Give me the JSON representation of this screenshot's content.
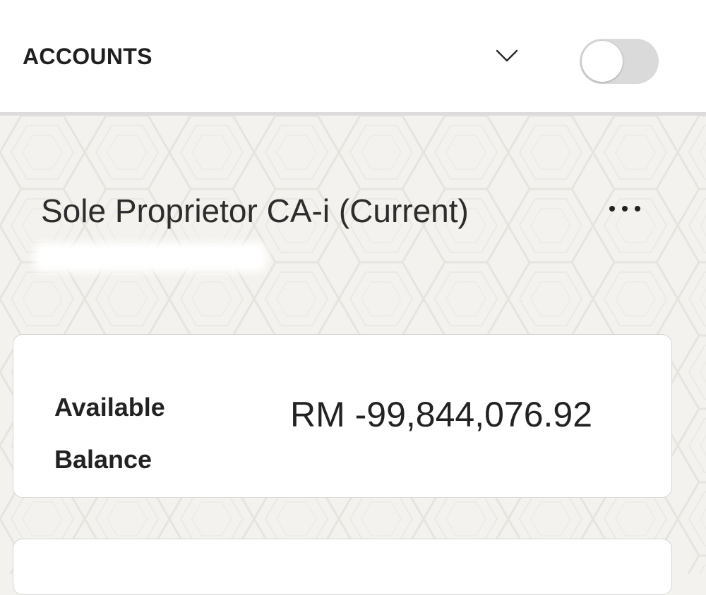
{
  "header": {
    "title": "ACCOUNTS",
    "chevron_icon": "chevron-down-icon",
    "toggle_state": "off"
  },
  "account": {
    "name": "Sole Proprietor CA-i (Current)",
    "more_icon": "more-horizontal-icon"
  },
  "balance": {
    "label": "Available Balance",
    "amount": "RM -99,844,076.92"
  },
  "colors": {
    "background": "#f3f2ee",
    "header_background": "#ffffff",
    "toggle_track": "#dadada",
    "text": "#222222"
  }
}
